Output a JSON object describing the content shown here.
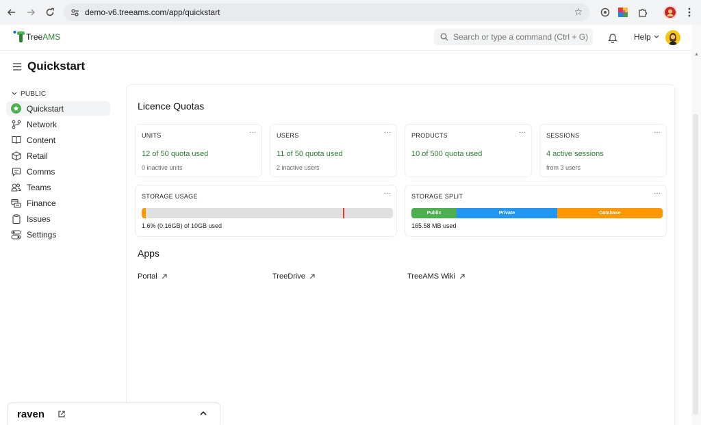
{
  "browser": {
    "url": "demo-v6.treeams.com/app/quickstart"
  },
  "app": {
    "logo_text_tree": "Tree",
    "logo_text_ams": "AMS",
    "search_placeholder": "Search or type a command (Ctrl + G)",
    "help_label": "Help"
  },
  "page": {
    "title": "Quickstart"
  },
  "sidebar": {
    "section_label": "PUBLIC",
    "items": [
      {
        "label": "Quickstart",
        "icon": "star-badge-icon",
        "active": true
      },
      {
        "label": "Network",
        "icon": "network-icon",
        "active": false
      },
      {
        "label": "Content",
        "icon": "book-icon",
        "active": false
      },
      {
        "label": "Retail",
        "icon": "box-icon",
        "active": false
      },
      {
        "label": "Comms",
        "icon": "message-icon",
        "active": false
      },
      {
        "label": "Teams",
        "icon": "users-icon",
        "active": false
      },
      {
        "label": "Finance",
        "icon": "finance-icon",
        "active": false
      },
      {
        "label": "Issues",
        "icon": "clipboard-icon",
        "active": false
      },
      {
        "label": "Settings",
        "icon": "toggles-icon",
        "active": false
      }
    ]
  },
  "quotas": {
    "heading": "Licence Quotas",
    "cards": [
      {
        "title": "UNITS",
        "main": "12 of 50 quota used",
        "sub": "0 inactive units"
      },
      {
        "title": "USERS",
        "main": "11 of 50 quota used",
        "sub": "2 inactive users"
      },
      {
        "title": "PRODUCTS",
        "main": "10 of 500 quota used",
        "sub": ""
      },
      {
        "title": "SESSIONS",
        "main": "4 active sessions",
        "sub": "from 3 users"
      }
    ],
    "more_label": "···",
    "storage_usage": {
      "title": "STORAGE USAGE",
      "summary": "1.6% (0.16GB) of 10GB used",
      "fill_fraction": 0.016,
      "marker_fraction": 0.8,
      "fill_color": "#ff9800",
      "marker_color": "#e53935"
    },
    "storage_split": {
      "title": "STORAGE SPLIT",
      "total": "165.58 MB used",
      "segments": [
        {
          "label": "Public",
          "fraction": 0.18,
          "color": "#4caf50"
        },
        {
          "label": "Private",
          "fraction": 0.4,
          "color": "#2196f3"
        },
        {
          "label": "Database",
          "fraction": 0.42,
          "color": "#ff9800"
        }
      ]
    }
  },
  "apps": {
    "heading": "Apps",
    "links": [
      {
        "label": "Portal"
      },
      {
        "label": "TreeDrive"
      },
      {
        "label": "TreeAMS Wiki"
      }
    ]
  },
  "raven": {
    "label": "raven"
  },
  "colors": {
    "accent_green": "#2e7d32",
    "active_icon_green": "#4caf50"
  }
}
